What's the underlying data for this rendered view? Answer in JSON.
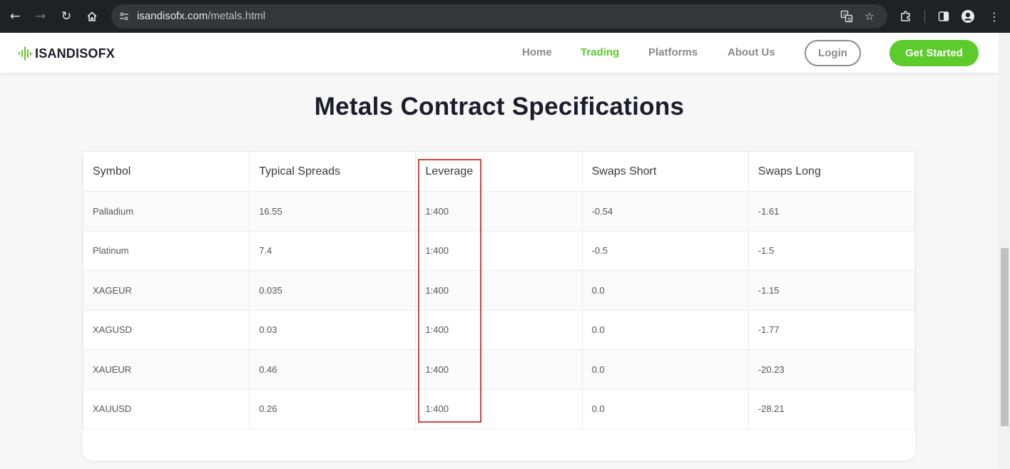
{
  "browser": {
    "url_domain": "isandisofx.com",
    "url_path": "/metals.html",
    "icons": {
      "back": "arrow-left-icon",
      "forward": "arrow-right-icon",
      "reload": "reload-icon",
      "home": "home-icon",
      "site_info": "tune-icon",
      "translate": "translate-icon",
      "bookmark": "star-icon",
      "extensions": "puzzle-icon",
      "side_panel": "side-panel-icon",
      "profile": "profile-icon",
      "menu": "kebab-menu-icon"
    }
  },
  "header": {
    "logo_text": "ISANDISOFX",
    "nav": [
      {
        "label": "Home",
        "active": false
      },
      {
        "label": "Trading",
        "active": true
      },
      {
        "label": "Platforms",
        "active": false
      },
      {
        "label": "About Us",
        "active": false
      }
    ],
    "login_label": "Login",
    "cta_label": "Get Started"
  },
  "main": {
    "title": "Metals Contract Specifications",
    "table": {
      "headers": [
        "Symbol",
        "Typical Spreads",
        "Leverage",
        "Swaps Short",
        "Swaps Long"
      ],
      "rows": [
        [
          "Palladium",
          "16.55",
          "1:400",
          "-0.54",
          "-1.61"
        ],
        [
          "Platinum",
          "7.4",
          "1:400",
          "-0.5",
          "-1.5"
        ],
        [
          "XAGEUR",
          "0.035",
          "1:400",
          "0.0",
          "-1.15"
        ],
        [
          "XAGUSD",
          "0.03",
          "1:400",
          "0.0",
          "-1.77"
        ],
        [
          "XAUEUR",
          "0.46",
          "1:400",
          "0.0",
          "-20.23"
        ],
        [
          "XAUUSD",
          "0.26",
          "1:400",
          "0.0",
          "-28.21"
        ]
      ]
    }
  },
  "colors": {
    "brand_green": "#5ccb2b",
    "heading": "#1c1c2b",
    "highlight": "#d9413a"
  }
}
